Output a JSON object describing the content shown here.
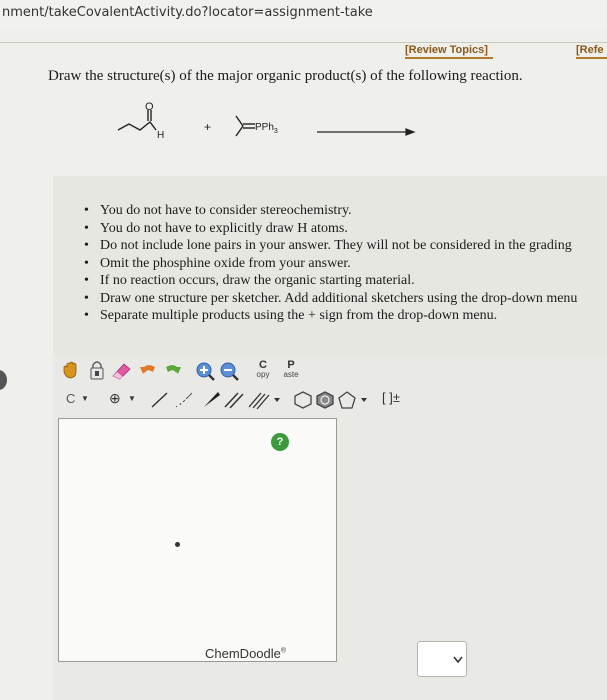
{
  "browser": {
    "url": "nment/takeCovalentActivity.do?locator=assignment-take"
  },
  "header": {
    "review_topics": "[Review Topics]",
    "references": "[Refe"
  },
  "question": {
    "text": "Draw the structure(s) of the major organic product(s) of the following reaction."
  },
  "reaction": {
    "aldehyde_o": "O",
    "aldehyde_h": "H",
    "plus": "+",
    "ylide_label": "PPh",
    "ylide_sub": "3"
  },
  "instructions": [
    "You do not have to consider stereochemistry.",
    "You do not have to explicitly draw H atoms.",
    "Do not include lone pairs in your answer. They will not be considered in the grading",
    "Omit the phosphine oxide from your answer.",
    "If no reaction occurs, draw the organic starting material.",
    "Draw one structure per sketcher. Add additional sketchers using the drop-down menu",
    "Separate multiple products using the + sign from the drop-down menu."
  ],
  "toolbar": {
    "copy_top": "C",
    "copy_bottom": "opy",
    "paste_top": "P",
    "paste_bottom": "aste",
    "element": "C",
    "charge": "⊕",
    "bracket": "[ ]±"
  },
  "sketcher": {
    "help": "?",
    "brand": "ChemDoodle",
    "brand_mark": "®"
  },
  "colors": {
    "help_green": "#3b9a3b",
    "review_link": "#8a5a1a"
  }
}
